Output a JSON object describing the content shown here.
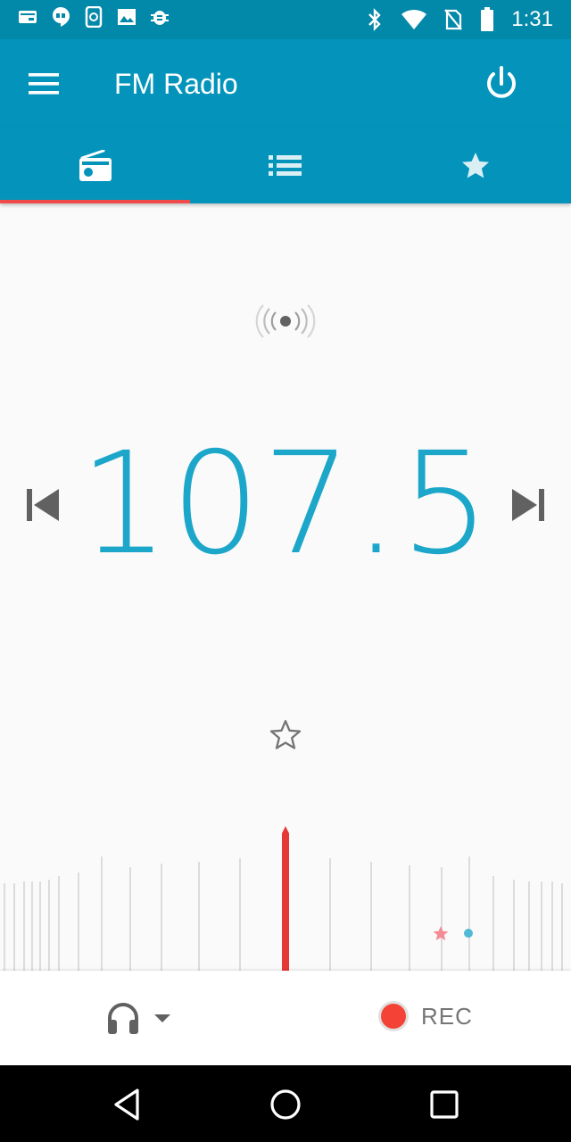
{
  "status_bar": {
    "time": "1:31",
    "left_icons": [
      "card-icon",
      "hangouts-icon",
      "phone-sync-icon",
      "image-icon",
      "bug-icon"
    ],
    "right_icons": [
      "bluetooth-icon",
      "wifi-icon",
      "no-sim-icon",
      "battery-icon"
    ]
  },
  "app_bar": {
    "title": "FM Radio",
    "menu_icon": "menu-icon",
    "power_icon": "power-icon"
  },
  "tabs": [
    {
      "icon": "radio-icon",
      "selected": true
    },
    {
      "icon": "list-icon",
      "selected": false
    },
    {
      "icon": "star-icon",
      "selected": false
    }
  ],
  "station": {
    "frequency": "107.5",
    "signal_icon": "broadcast-icon",
    "favorite": false
  },
  "controls": {
    "audio_output_icon": "headphones-icon",
    "rec_label": "REC"
  },
  "colors": {
    "primary": "#0494bb",
    "status_bar": "#0288a8",
    "accent": "#f04b4b",
    "frequency_text": "#1ca6c9"
  }
}
